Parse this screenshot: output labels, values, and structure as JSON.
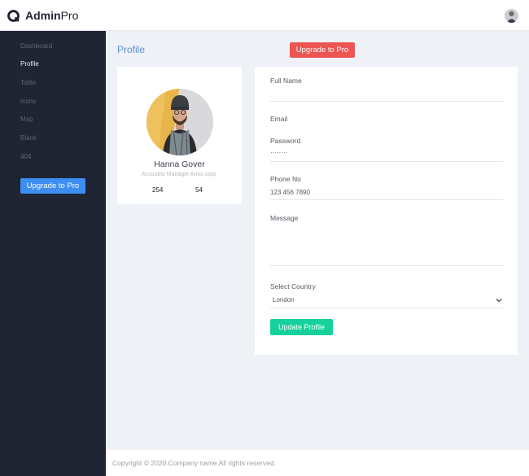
{
  "header": {
    "brand_bold": "Admin",
    "brand_light": "Pro",
    "logo_icon": "q-logo-icon",
    "avatar_icon": "user-avatar-icon"
  },
  "sidebar": {
    "items": [
      {
        "label": "Dashboard",
        "active": false
      },
      {
        "label": "Profile",
        "active": true
      },
      {
        "label": "Table",
        "active": false
      },
      {
        "label": "Icons",
        "active": false
      },
      {
        "label": "Map",
        "active": false
      },
      {
        "label": "Blank",
        "active": false
      },
      {
        "label": "404",
        "active": false
      }
    ],
    "upgrade_label": "Upgrade to Pro"
  },
  "main": {
    "title": "Profile",
    "upgrade_label": "Upgrade to Pro"
  },
  "profile": {
    "name": "Hanna Gover",
    "role": "Accoubts Manager Amix corp.",
    "stat_1": "254",
    "stat_2": "54"
  },
  "form": {
    "full_name_label": "Full Name",
    "full_name_value": "",
    "email_label": "Email",
    "email_value": "",
    "password_label": "Password",
    "password_value": "········",
    "phone_label": "Phone No",
    "phone_value": "123 456 7890",
    "message_label": "Message",
    "message_value": "",
    "country_label": "Select Country",
    "country_value": "London",
    "submit_label": "Update Profile"
  },
  "footer": {
    "text": "Copyright © 2020.Company name All rights reserved."
  },
  "colors": {
    "sidebar_bg": "#1f2533",
    "accent_blue": "#3d8ef2",
    "accent_red": "#ec5552",
    "accent_green": "#16d19d",
    "title_blue": "#5d8fd1"
  }
}
